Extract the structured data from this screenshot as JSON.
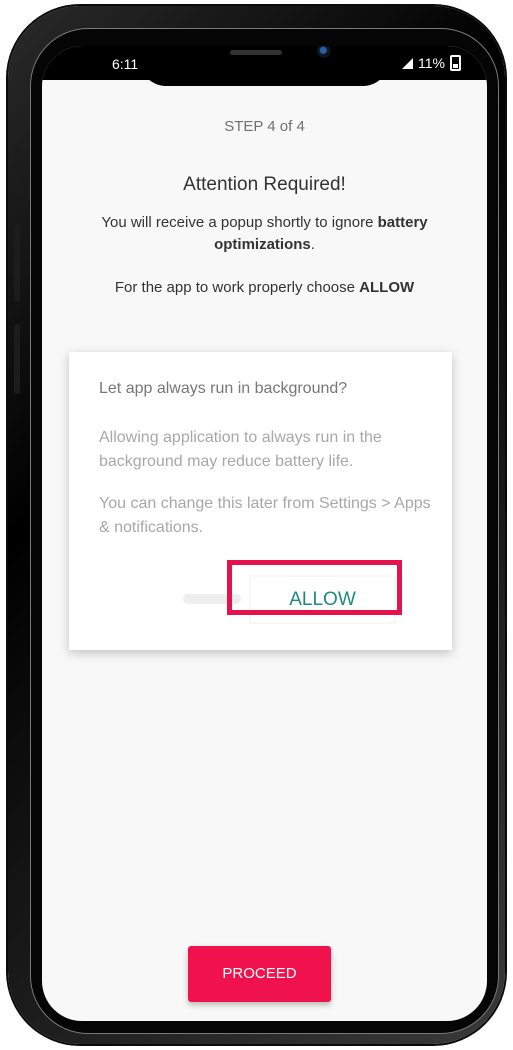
{
  "status_bar": {
    "time": "6:11",
    "battery_percent": "11%",
    "icons": [
      "signal-icon",
      "battery-icon"
    ]
  },
  "step_label": "STEP 4 of  4",
  "title": "Attention Required!",
  "message1": {
    "prefix": "You will receive a popup shortly to ignore ",
    "bold": "battery optimizations",
    "suffix": "."
  },
  "message2": {
    "prefix": "For the app to work properly choose ",
    "bold": "ALLOW"
  },
  "dialog": {
    "title": "Let app always run in background?",
    "body1": "Allowing application to always run in the background may reduce battery life.",
    "body2": "You can change this later from Settings > Apps & notifications.",
    "allow_label": "ALLOW"
  },
  "proceed_label": "PROCEED",
  "colors": {
    "accent": "#f0124d",
    "highlight_border": "#e5124d",
    "allow_text": "#1f8a7d",
    "screen_bg": "#f8f8f8"
  }
}
